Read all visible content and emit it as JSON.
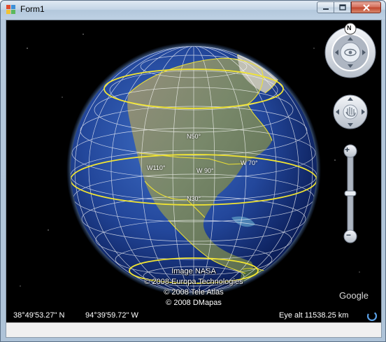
{
  "window": {
    "title": "Form1",
    "icons": {
      "app": "application-icon",
      "minimize": "minimize-icon",
      "maximize": "maximize-icon",
      "close": "close-icon"
    }
  },
  "map": {
    "grid_labels": {
      "n50": "N50°",
      "n30": "N30°",
      "w110": "W110°",
      "w90": "W 90°",
      "w70": "W 70°"
    },
    "credits": {
      "line1": "Image NASA",
      "line2": "© 2008 Europa Technologies",
      "line3": "© 2008 Tele Atlas",
      "line4": "© 2008 DMapas"
    },
    "logo_text": "Google",
    "latitude": "38°49'53.27\" N",
    "longitude": "94°39'59.72\" W",
    "eye_alt": "Eye alt 11538.25 km",
    "compass_north": "N"
  },
  "controls": {
    "look_joystick": "eye-icon",
    "move_joystick": "hand-icon",
    "zoom_in": "+",
    "zoom_out": "−",
    "streaming": "streaming-indicator-icon"
  },
  "colors": {
    "space": "#000000",
    "ocean": "#1f3f8f",
    "graticule": "#ffffff",
    "borders": "#f2e532",
    "titlebar": "#c4d5e6"
  }
}
